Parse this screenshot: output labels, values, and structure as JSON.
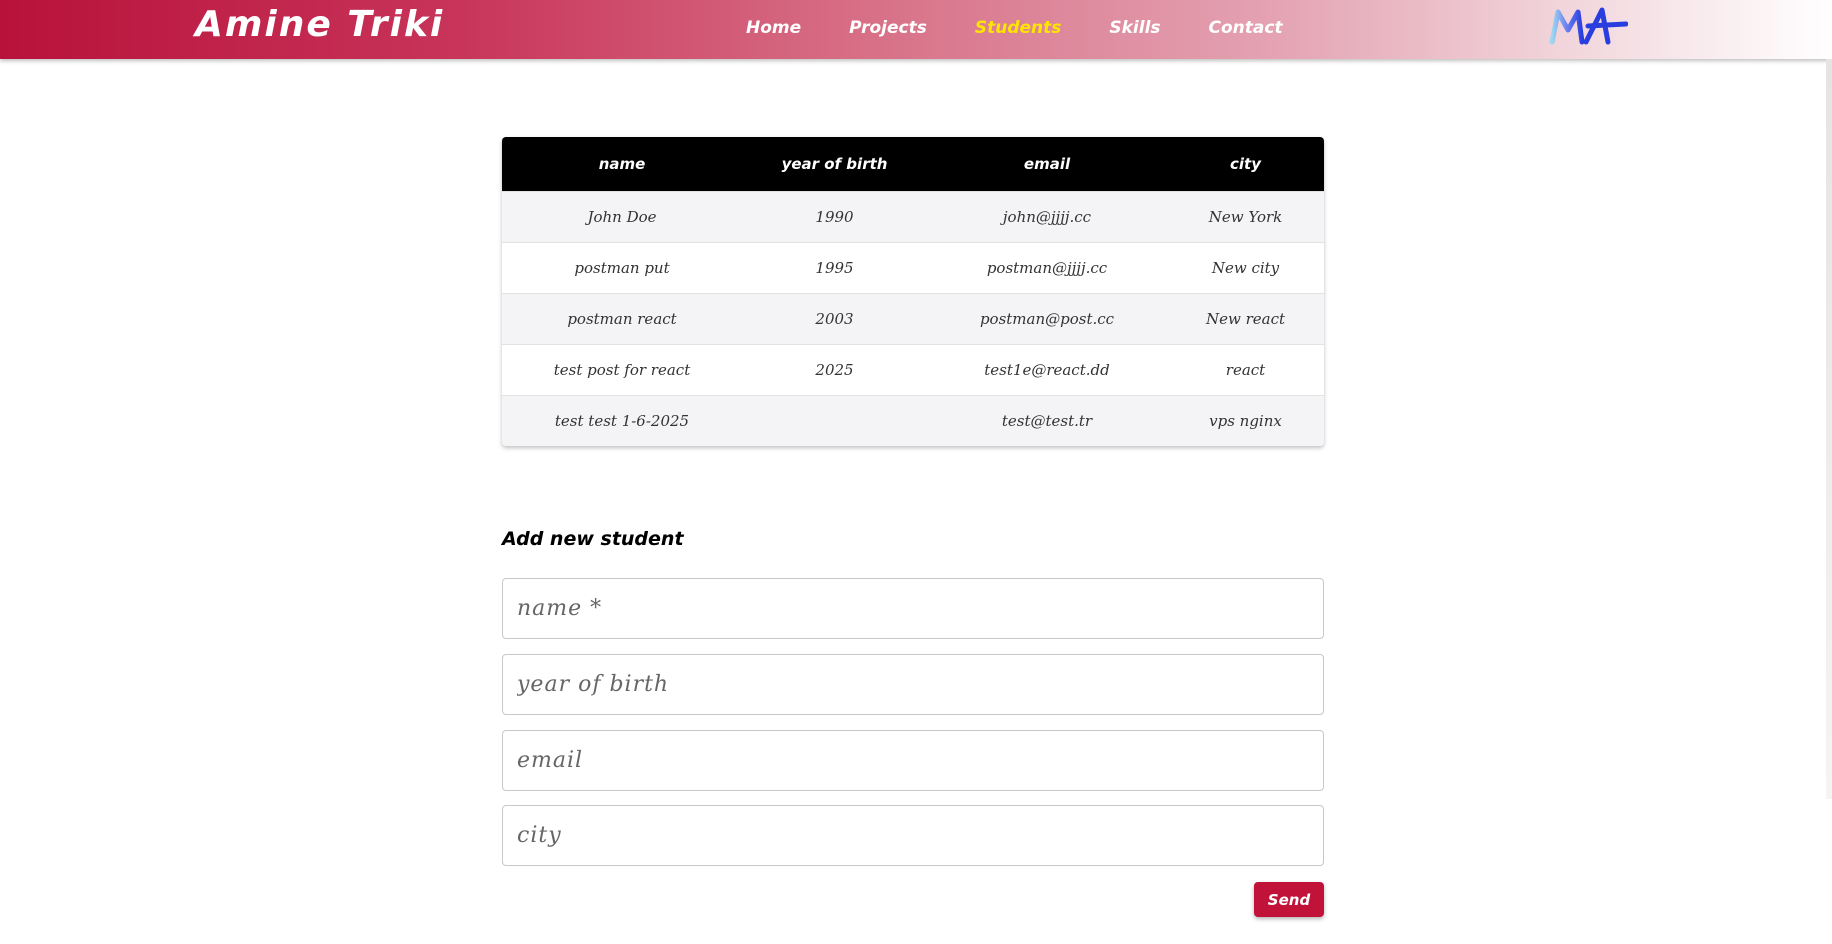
{
  "header": {
    "brand": "Amine Triki",
    "nav": [
      {
        "label": "Home",
        "active": false
      },
      {
        "label": "Projects",
        "active": false
      },
      {
        "label": "Students",
        "active": true
      },
      {
        "label": "Skills",
        "active": false
      },
      {
        "label": "Contact",
        "active": false
      }
    ],
    "logo_icon": "ma-monogram-logo",
    "colors": {
      "brand_red": "#b8123a",
      "active_nav": "#ffe600"
    }
  },
  "table": {
    "columns": [
      "name",
      "year of birth",
      "email",
      "city"
    ],
    "rows": [
      [
        "John Doe",
        "1990",
        "john@jjjj.cc",
        "New York"
      ],
      [
        "postman put",
        "1995",
        "postman@jjjj.cc",
        "New city"
      ],
      [
        "postman react",
        "2003",
        "postman@post.cc",
        "New react"
      ],
      [
        "test post for react",
        "2025",
        "test1e@react.dd",
        "react"
      ],
      [
        "test test 1-6-2025",
        "",
        "test@test.tr",
        "vps nginx"
      ]
    ]
  },
  "form": {
    "title": "Add new student",
    "fields": [
      {
        "placeholder": "name *",
        "value": ""
      },
      {
        "placeholder": "year of birth",
        "value": ""
      },
      {
        "placeholder": "email",
        "value": ""
      },
      {
        "placeholder": "city",
        "value": ""
      }
    ],
    "submit_label": "Send",
    "colors": {
      "button": "#c1123a"
    }
  }
}
